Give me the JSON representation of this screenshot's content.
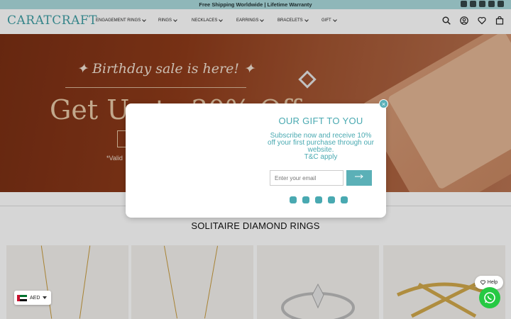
{
  "announcement": {
    "text": "Free Shipping Worldwide | Lifetime Warranty"
  },
  "top_social": [
    "instagram-icon",
    "facebook-icon",
    "youtube-icon",
    "pinterest-icon",
    "tiktok-icon"
  ],
  "header": {
    "logo": "CARATCRAFT",
    "nav": [
      "ENGAGEMENT RINGS",
      "RINGS",
      "NECKLACES",
      "EARRINGS",
      "BRACELETS",
      "GIFT"
    ],
    "icons": [
      "search-icon",
      "account-icon",
      "wishlist-icon",
      "cart-icon"
    ]
  },
  "hero": {
    "subtitle": "✦ Birthday sale is here! ✦",
    "headline": "Get Up to 30% Off",
    "note": "*Valid"
  },
  "popup": {
    "title": "OUR GIFT TO YOU",
    "text": "Subscribe now and receive 10% off your first purchase through our website.",
    "tc": "T&C apply",
    "email_placeholder": "Enter your email",
    "submit_icon": "arrow-right-icon",
    "close_label": "×",
    "social": [
      "instagram-icon",
      "facebook-icon",
      "youtube-icon",
      "pinterest-icon",
      "tiktok-icon"
    ]
  },
  "section": {
    "title": "SOLITAIRE DIAMOND RINGS"
  },
  "currency": {
    "code": "AED",
    "flag": "uae-flag-icon"
  },
  "help": {
    "label": "Help"
  },
  "colors": {
    "accent": "#49a9b1",
    "announce_bg": "#8fb7b9",
    "hero_bg": "#8e3b1a",
    "whatsapp": "#26c943"
  }
}
